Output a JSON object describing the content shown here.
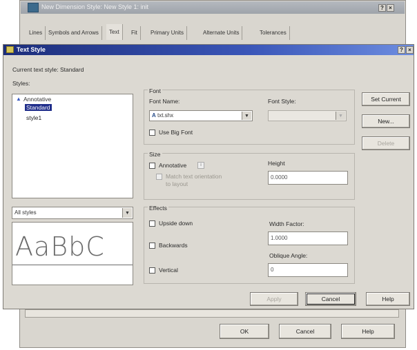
{
  "back_dialog": {
    "title": "New Dimension Style: New Style 1: init",
    "tabs": [
      "Lines",
      "Symbols and Arrows",
      "Text",
      "Fit",
      "Primary Units",
      "Alternate Units",
      "Tolerances"
    ],
    "ok_label": "OK",
    "cancel_label": "Cancel",
    "help_label": "Help"
  },
  "dialog": {
    "title": "Text Style",
    "current_style": "Current text style:  Standard",
    "styles_label": "Styles:",
    "styles": [
      "Annotative",
      "Standard",
      "style1"
    ],
    "filter_value": "All styles",
    "preview_text": "AaBbC",
    "font": {
      "group_label": "Font",
      "name_label": "Font Name:",
      "name_value": "txt.shx",
      "style_label": "Font Style:",
      "style_value": "",
      "big_font_label": "Use Big Font"
    },
    "size": {
      "group_label": "Size",
      "annotative_label": "Annotative",
      "match_label_1": "Match text orientation",
      "match_label_2": "to layout",
      "height_label": "Height",
      "height_value": "0.0000"
    },
    "effects": {
      "group_label": "Effects",
      "upside_down_label": "Upside down",
      "backwards_label": "Backwards",
      "vertical_label": "Vertical",
      "width_label": "Width Factor:",
      "width_value": "1.0000",
      "oblique_label": "Oblique Angle:",
      "oblique_value": "0"
    },
    "buttons": {
      "set_current": "Set Current",
      "new": "New...",
      "delete": "Delete",
      "apply": "Apply",
      "cancel": "Cancel",
      "help": "Help"
    }
  }
}
